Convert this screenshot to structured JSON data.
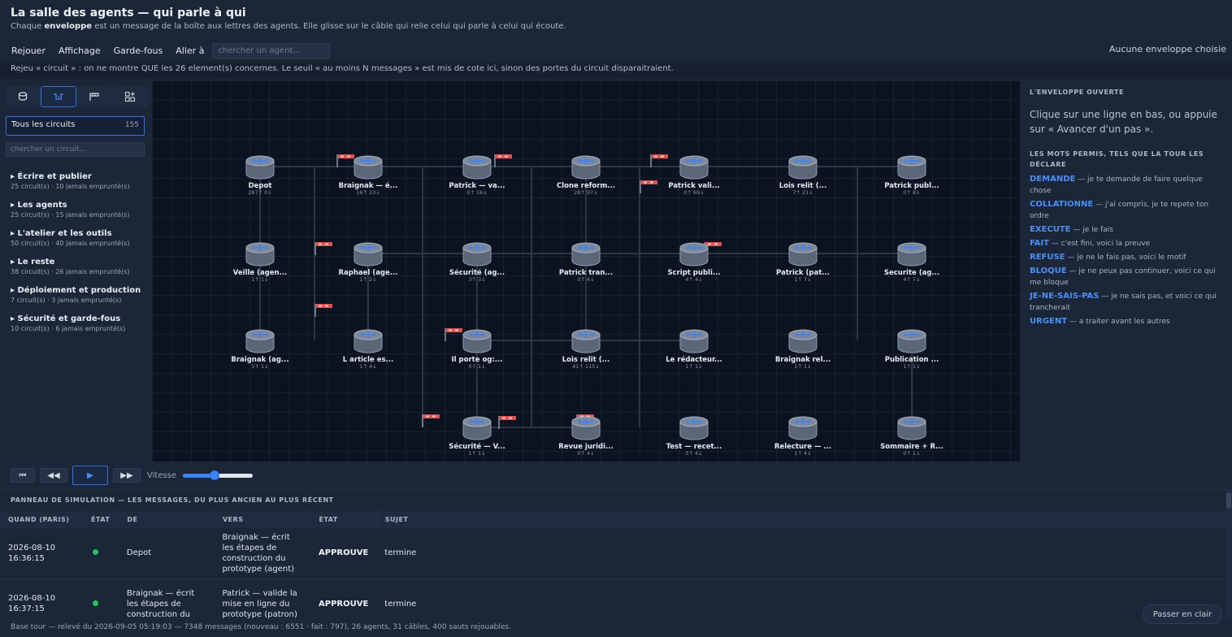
{
  "header": {
    "title": "La salle des agents — qui parle à qui",
    "subtitle_pre": "Chaque ",
    "subtitle_bold": "enveloppe",
    "subtitle_post": " est un message de la boîte aux lettres des agents. Elle glisse sur le câble qui relie celui qui parle à celui qui écoute."
  },
  "menu": {
    "items": [
      "Rejouer",
      "Affichage",
      "Garde-fous",
      "Aller à"
    ],
    "search_placeholder": "chercher un agent...",
    "selection_status": "Aucune enveloppe choisie"
  },
  "notice": "Rejeu « circuit » : on ne montre QUE les 26 element(s) concernes. Le seuil « au moins N messages » est mis de cote ici, sinon des portes du circuit disparaitraient.",
  "sidebar": {
    "icons": [
      "database-icon",
      "waveform-icon",
      "flag-icon",
      "grid-add-icon"
    ],
    "all_label": "Tous les circuits",
    "all_count": "155",
    "search_placeholder": "chercher un circuit...",
    "groups": [
      {
        "title": "▸ Écrire et publier",
        "sub": "25 circuit(s) · 10 jamais emprunté(s)"
      },
      {
        "title": "▸ Les agents",
        "sub": "25 circuit(s) · 15 jamais emprunté(s)"
      },
      {
        "title": "▸ L'atelier et les outils",
        "sub": "50 circuit(s) · 40 jamais emprunté(s)"
      },
      {
        "title": "▸ Le reste",
        "sub": "38 circuit(s) · 26 jamais emprunté(s)"
      },
      {
        "title": "▸ Déploiement et production",
        "sub": "7 circuit(s) · 3 jamais emprunté(s)"
      },
      {
        "title": "▸ Sécurité et garde-fous",
        "sub": "10 circuit(s) · 6 jamais emprunté(s)"
      }
    ]
  },
  "graph": {
    "nodes": [
      {
        "label": "Depot",
        "stats": "287↑ 0↓",
        "row": 0,
        "col": 0
      },
      {
        "label": "Braignak — é...",
        "stats": "16↑ 23↓",
        "row": 0,
        "col": 1
      },
      {
        "label": "Patrick — va...",
        "stats": "0↑ 16↓",
        "row": 0,
        "col": 2
      },
      {
        "label": "Clone reform...",
        "stats": "28↑ 97↓",
        "row": 0,
        "col": 3
      },
      {
        "label": "Patrick vali...",
        "stats": "0↑ 69↓",
        "row": 0,
        "col": 4
      },
      {
        "label": "Lois relit (...",
        "stats": "7↑ 21↓",
        "row": 0,
        "col": 5
      },
      {
        "label": "Patrick publ...",
        "stats": "0↑ 8↓",
        "row": 0,
        "col": 6
      },
      {
        "label": "Veille (agen...",
        "stats": "1↑ 1↓",
        "row": 1,
        "col": 0
      },
      {
        "label": "Raphael (age...",
        "stats": "1↑ 2↓",
        "row": 1,
        "col": 1
      },
      {
        "label": "Sécurité (ag...",
        "stats": "3↑ 3↓",
        "row": 1,
        "col": 2
      },
      {
        "label": "Patrick tran...",
        "stats": "0↑ 4↓",
        "row": 1,
        "col": 3
      },
      {
        "label": "Script publi...",
        "stats": "4↑ 4↓",
        "row": 1,
        "col": 4
      },
      {
        "label": "Patrick (pat...",
        "stats": "1↑ 7↓",
        "row": 1,
        "col": 5
      },
      {
        "label": "Securite (ag...",
        "stats": "4↑ 7↓",
        "row": 1,
        "col": 6
      },
      {
        "label": "Braignak (ag...",
        "stats": "1↑ 1↓",
        "row": 2,
        "col": 0
      },
      {
        "label": "L article es...",
        "stats": "1↑ 4↓",
        "row": 2,
        "col": 1
      },
      {
        "label": "Il porte og:...",
        "stats": "0↑ 1↓",
        "row": 2,
        "col": 2
      },
      {
        "label": "Lois relit (...",
        "stats": "41↑ 115↓",
        "row": 2,
        "col": 3
      },
      {
        "label": "Le rédacteur...",
        "stats": "1↑ 1↓",
        "row": 2,
        "col": 4
      },
      {
        "label": "Braignak rel...",
        "stats": "1↑ 1↓",
        "row": 2,
        "col": 5
      },
      {
        "label": "Publication ...",
        "stats": "1↑ 1↓",
        "row": 2,
        "col": 6
      },
      {
        "label": "Sécurité — V...",
        "stats": "1↑ 1↓",
        "row": 3,
        "col": 2
      },
      {
        "label": "Revue juridi...",
        "stats": "0↑ 4↓",
        "row": 3,
        "col": 3
      },
      {
        "label": "Test — recet...",
        "stats": "0↑ 4↓",
        "row": 3,
        "col": 4
      },
      {
        "label": "Relecture — ...",
        "stats": "1↑ 4↓",
        "row": 3,
        "col": 5
      },
      {
        "label": "Sommaire + R...",
        "stats": "0↑ 1↓",
        "row": 3,
        "col": 6
      }
    ]
  },
  "right_panel": {
    "heading": "L'ENVELOPPE OUVERTE",
    "intro": "Clique sur une ligne en bas, ou appuie sur « Avancer d'un pas ».",
    "verbs_heading": "LES MOTS PERMIS, TELS QUE LA TOUR LES DÉCLARE",
    "verbs": [
      {
        "k": "DEMANDE",
        "d": " — je te demande de faire quelque chose"
      },
      {
        "k": "COLLATIONNE",
        "d": " — j'ai compris, je te repete ton ordre"
      },
      {
        "k": "EXECUTE",
        "d": " — je le fais"
      },
      {
        "k": "FAIT",
        "d": " — c'est fini, voici la preuve"
      },
      {
        "k": "REFUSE",
        "d": " — je ne le fais pas, voici le motif"
      },
      {
        "k": "BLOQUE",
        "d": " — je ne peux pas continuer, voici ce qui me bloque"
      },
      {
        "k": "JE-NE-SAIS-PAS",
        "d": " — je ne sais pas, et voici ce qui trancherait"
      },
      {
        "k": "URGENT",
        "d": " — a traiter avant les autres"
      }
    ]
  },
  "controls": {
    "first": "⏮",
    "back": "◀◀",
    "play": "▶",
    "forward": "▶▶",
    "speed_label": "Vitesse",
    "speed_value": 0.45
  },
  "simulation": {
    "title": "PANNEAU DE SIMULATION — LES MESSAGES, DU PLUS ANCIEN AU PLUS RÉCENT",
    "columns": [
      "QUAND (PARIS)",
      "ÉTAT",
      "DE",
      "VERS",
      "ÉTAT",
      "SUJET"
    ],
    "rows": [
      {
        "when": "2026-08-10 16:36:15",
        "from": "Depot",
        "to": "Braignak — écrit les étapes de construction du prototype (agent)",
        "state": "APPROUVE",
        "subject": "termine"
      },
      {
        "when": "2026-08-10 16:37:15",
        "from": "Braignak — écrit les étapes de construction du",
        "to": "Patrick — valide la mise en ligne du prototype (patron)",
        "state": "APPROUVE",
        "subject": "termine"
      }
    ]
  },
  "footer": "Base tour — relevé du 2026-09-05 05:19:03 — 7348 messages (nouveau : 6551 · fait : 797), 26 agents, 31 câbles, 400 sauts rejouables.",
  "clear_button": "Passer en clair",
  "colors": {
    "accent": "#3b82f6",
    "flag": "#e05252",
    "ok": "#22c55e"
  }
}
